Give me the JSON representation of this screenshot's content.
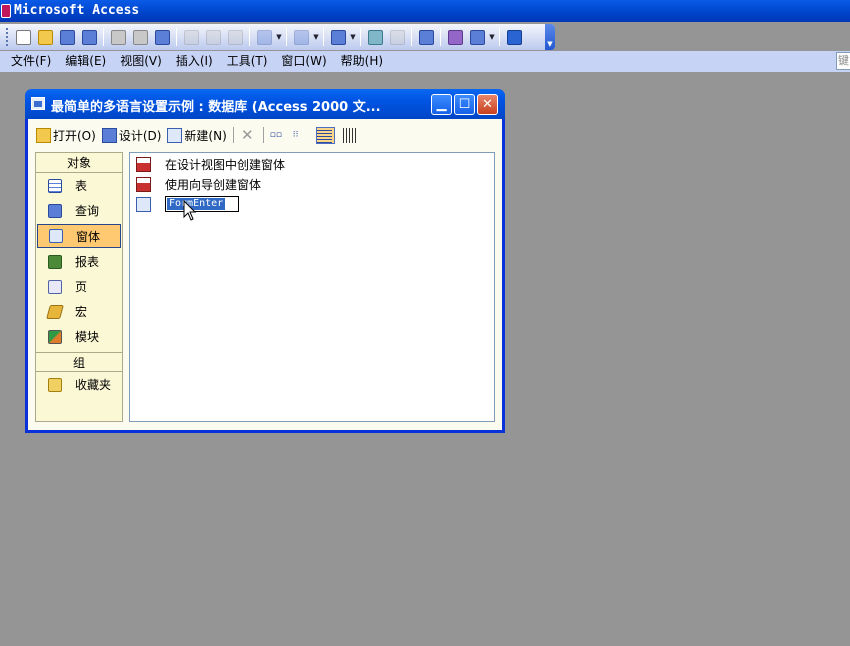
{
  "app": {
    "title": "Microsoft Access"
  },
  "toolbar": {
    "buttons": [
      {
        "name": "new-icon",
        "color": "new"
      },
      {
        "name": "open-icon",
        "color": "open"
      },
      {
        "name": "save-icon",
        "color": "blue"
      },
      {
        "name": "file-search-icon",
        "color": "blue"
      },
      {
        "name": "print-icon",
        "color": "gray"
      },
      {
        "name": "print-preview-icon",
        "color": "gray"
      },
      {
        "name": "spelling-icon",
        "color": "blue"
      },
      {
        "name": "cut-icon",
        "color": "gray",
        "disabled": true
      },
      {
        "name": "copy-icon",
        "color": "gray",
        "disabled": true
      },
      {
        "name": "paste-icon",
        "color": "gray",
        "disabled": true
      },
      {
        "name": "undo-icon",
        "color": "blue",
        "disabled": true
      },
      {
        "name": "office-links-icon",
        "color": "blue",
        "disabled": true
      },
      {
        "name": "analyze-icon",
        "color": "blue"
      },
      {
        "name": "code-icon",
        "color": "teal"
      },
      {
        "name": "script-editor-icon",
        "color": "gray",
        "disabled": true
      },
      {
        "name": "properties-icon",
        "color": "blue"
      },
      {
        "name": "relationships-icon",
        "color": "purple"
      },
      {
        "name": "new-object-icon",
        "color": "blue"
      },
      {
        "name": "help-icon",
        "color": "help"
      }
    ]
  },
  "menu": {
    "items": [
      "文件(F)",
      "编辑(E)",
      "视图(V)",
      "插入(I)",
      "工具(T)",
      "窗口(W)",
      "帮助(H)"
    ],
    "help_placeholder": "键"
  },
  "db_window": {
    "title": "最简单的多语言设置示例 : 数据库 (Access 2000 文...",
    "toolbar": {
      "open": "打开(O)",
      "design": "设计(D)",
      "new": "新建(N)"
    },
    "objects_header": "对象",
    "objects": [
      {
        "label": "表",
        "icon": "table-icon",
        "color": "table"
      },
      {
        "label": "查询",
        "icon": "query-icon",
        "color": "blue"
      },
      {
        "label": "窗体",
        "icon": "form-icon",
        "color": "form",
        "selected": true
      },
      {
        "label": "报表",
        "icon": "report-icon",
        "color": "report"
      },
      {
        "label": "页",
        "icon": "page-icon",
        "color": "page"
      },
      {
        "label": "宏",
        "icon": "macro-icon",
        "color": "macro"
      },
      {
        "label": "模块",
        "icon": "module-icon",
        "color": "module"
      }
    ],
    "groups_header": "组",
    "groups": [
      {
        "label": "收藏夹",
        "icon": "favorites-icon",
        "color": "fav"
      }
    ],
    "list": [
      {
        "label": "在设计视图中创建窗体",
        "icon": "form-wizard-icon",
        "color": "wiz"
      },
      {
        "label": "使用向导创建窗体",
        "icon": "form-wizard-icon",
        "color": "wiz"
      }
    ],
    "editing_item": "FormEnter"
  }
}
